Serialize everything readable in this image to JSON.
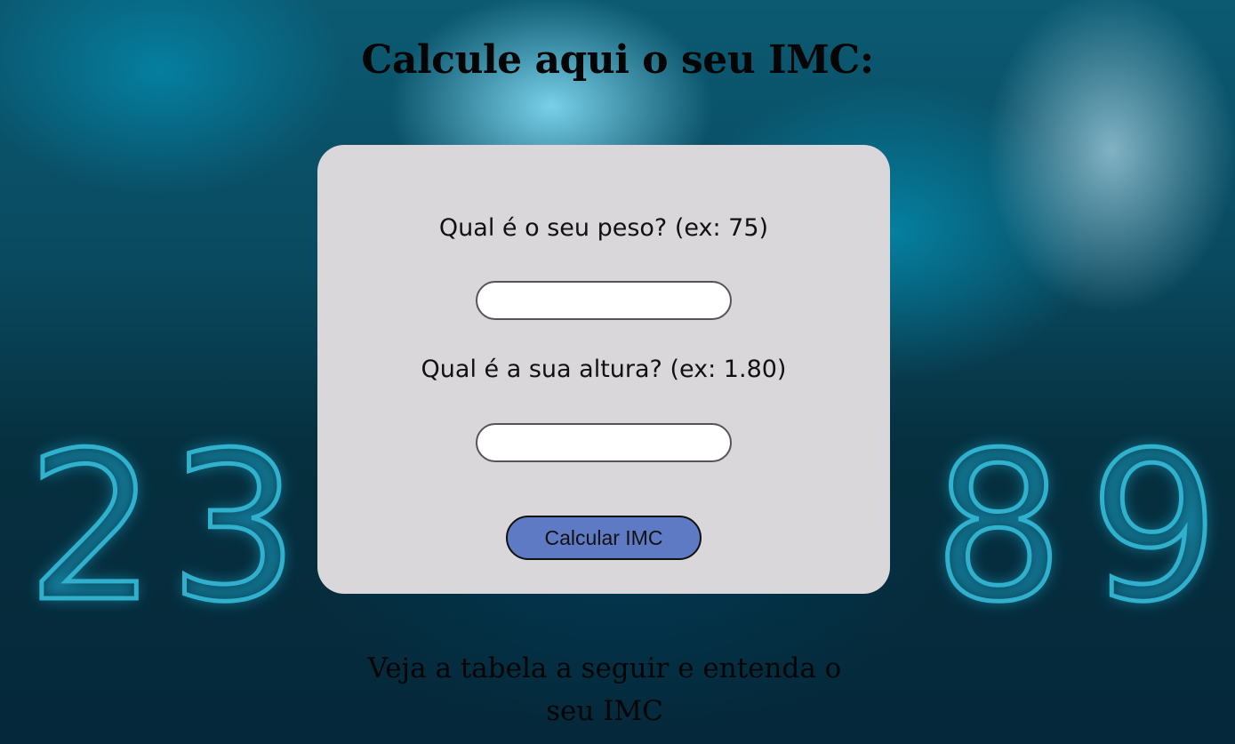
{
  "page": {
    "title": "Calcule aqui o seu IMC:",
    "subtitle": "Veja a tabela a seguir e entenda o seu IMC"
  },
  "background": {
    "digits": [
      "2",
      "3",
      "8",
      "9"
    ]
  },
  "form": {
    "weight_label": "Qual é o seu peso? (ex: 75)",
    "weight_value": "",
    "height_label": "Qual é a sua altura? (ex: 1.80)",
    "height_value": "",
    "submit_label": "Calcular IMC"
  },
  "colors": {
    "card": "#dad7da",
    "button": "#5e7ac4",
    "background": "#0a4a60"
  }
}
